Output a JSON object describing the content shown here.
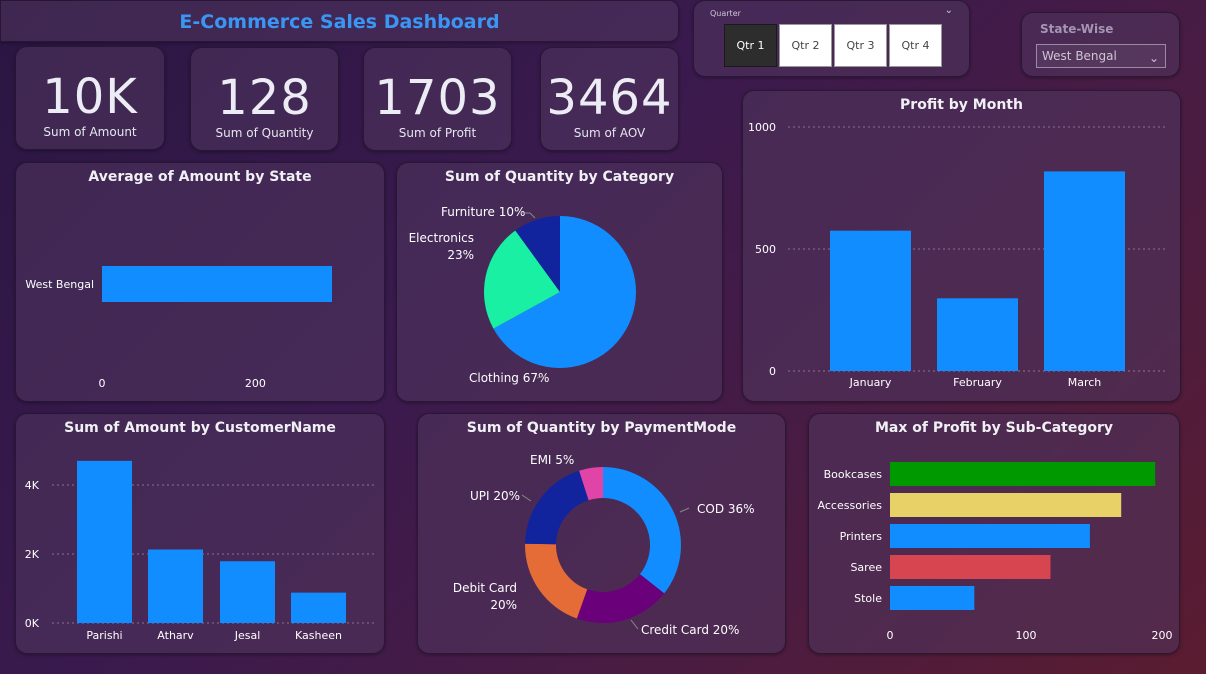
{
  "dashboard": {
    "title": "E-Commerce Sales Dashboard"
  },
  "kpis": [
    {
      "value": "10K",
      "label": "Sum of Amount"
    },
    {
      "value": "128",
      "label": "Sum of Quantity"
    },
    {
      "value": "1703",
      "label": "Sum of Profit"
    },
    {
      "value": "3464",
      "label": "Sum of AOV"
    }
  ],
  "quarter_slicer": {
    "label": "Quarter",
    "options": [
      "Qtr 1",
      "Qtr 2",
      "Qtr 3",
      "Qtr 4"
    ],
    "selected": "Qtr 1"
  },
  "state_slicer": {
    "label": "State-Wise",
    "selected": "West Bengal"
  },
  "colors": {
    "accent": "#118dff",
    "green": "#1af0a4",
    "navy": "#12239e",
    "purple": "#6b007b",
    "orange": "#e66c37",
    "magenta": "#e044a7",
    "bar_green": "#009a00",
    "bar_yellow": "#e8d166",
    "bar_red": "#d64550"
  },
  "chart_data": [
    {
      "id": "avg_amount_state",
      "type": "bar",
      "orientation": "horizontal",
      "title": "Average of Amount by State",
      "categories": [
        "West Bengal"
      ],
      "values": [
        300
      ],
      "xlim": [
        0,
        300
      ],
      "xticks": [
        "0",
        "200"
      ]
    },
    {
      "id": "qty_category",
      "type": "pie",
      "title": "Sum of Quantity by Category",
      "categories": [
        "Clothing",
        "Electronics",
        "Furniture"
      ],
      "values": [
        67,
        23,
        10
      ],
      "labels": [
        "Clothing 67%",
        "Electronics 23%",
        "Furniture 10%"
      ]
    },
    {
      "id": "profit_month",
      "type": "bar",
      "title": "Profit by Month",
      "categories": [
        "January",
        "February",
        "March"
      ],
      "values": [
        575,
        298,
        818
      ],
      "ylim": [
        0,
        1000
      ],
      "yticks": [
        "0",
        "500",
        "1000"
      ],
      "grid": true
    },
    {
      "id": "amount_customer",
      "type": "bar",
      "title": "Sum of Amount by CustomerName",
      "categories": [
        "Parishi",
        "Atharv",
        "Jesal",
        "Kasheen"
      ],
      "values": [
        4700,
        2130,
        1790,
        880
      ],
      "ylim": [
        0,
        4800
      ],
      "yticks": [
        "0K",
        "2K",
        "4K"
      ],
      "grid": true
    },
    {
      "id": "qty_payment",
      "type": "pie",
      "donut": true,
      "title": "Sum of Quantity by PaymentMode",
      "categories": [
        "COD",
        "Credit Card",
        "Debit Card",
        "UPI",
        "EMI"
      ],
      "values": [
        36,
        20,
        20,
        20,
        5
      ],
      "labels": [
        "COD 36%",
        "Credit Card 20%",
        "Debit Card 20%",
        "UPI 20%",
        "EMI 5%"
      ]
    },
    {
      "id": "max_profit_subcat",
      "type": "bar",
      "orientation": "horizontal",
      "title": "Max of Profit by Sub-Category",
      "categories": [
        "Bookcases",
        "Accessories",
        "Printers",
        "Saree",
        "Stole"
      ],
      "values": [
        195,
        170,
        147,
        118,
        62
      ],
      "xlim": [
        0,
        200
      ],
      "xticks": [
        "0",
        "100",
        "200"
      ]
    }
  ]
}
